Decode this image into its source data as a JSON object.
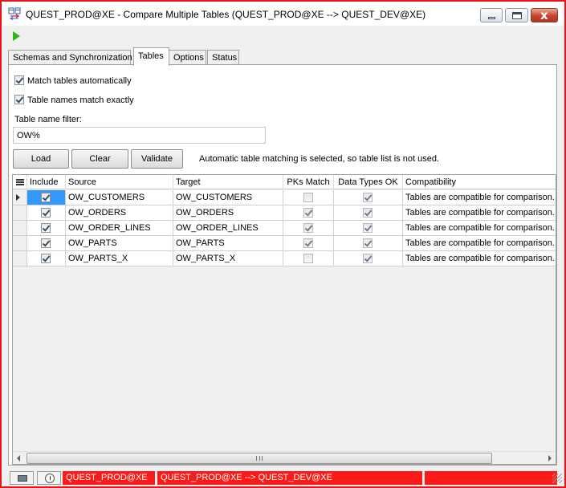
{
  "window": {
    "title": "QUEST_PROD@XE - Compare Multiple Tables (QUEST_PROD@XE --> QUEST_DEV@XE)"
  },
  "tabs": [
    {
      "label": "Schemas and Synchronization",
      "active": false
    },
    {
      "label": "Tables",
      "active": true
    },
    {
      "label": "Options",
      "active": false
    },
    {
      "label": "Status",
      "active": false
    }
  ],
  "options": {
    "match_auto_label": "Match tables automatically",
    "match_auto_checked": true,
    "names_exact_label": "Table names match exactly",
    "names_exact_checked": true,
    "filter_label": "Table name filter:",
    "filter_value": "OW%"
  },
  "buttons": {
    "load": "Load",
    "clear": "Clear",
    "validate": "Validate"
  },
  "info_text": "Automatic table matching is selected, so table list is not used.",
  "grid": {
    "headers": {
      "include": "Include",
      "source": "Source",
      "target": "Target",
      "pks_match": "PKs Match",
      "data_types_ok": "Data Types OK",
      "compatibility": "Compatibility"
    },
    "rows": [
      {
        "include": true,
        "source": "OW_CUSTOMERS",
        "target": "OW_CUSTOMERS",
        "pks_match": false,
        "data_types_ok": true,
        "compatibility": "Tables are compatible for comparison."
      },
      {
        "include": true,
        "source": "OW_ORDERS",
        "target": "OW_ORDERS",
        "pks_match": true,
        "data_types_ok": true,
        "compatibility": "Tables are compatible for comparison."
      },
      {
        "include": true,
        "source": "OW_ORDER_LINES",
        "target": "OW_ORDER_LINES",
        "pks_match": true,
        "data_types_ok": true,
        "compatibility": "Tables are compatible for comparison."
      },
      {
        "include": true,
        "source": "OW_PARTS",
        "target": "OW_PARTS",
        "pks_match": true,
        "data_types_ok": true,
        "compatibility": "Tables are compatible for comparison."
      },
      {
        "include": true,
        "source": "OW_PARTS_X",
        "target": "OW_PARTS_X",
        "pks_match": false,
        "data_types_ok": true,
        "compatibility": "Tables are compatible for comparison."
      }
    ]
  },
  "statusbar": {
    "connection": "QUEST_PROD@XE",
    "comparison": "QUEST_PROD@XE --> QUEST_DEV@XE",
    "accent": "#ff1a1a"
  },
  "icons": {
    "app": "table-compare-icon",
    "run": "run-play-icon"
  }
}
